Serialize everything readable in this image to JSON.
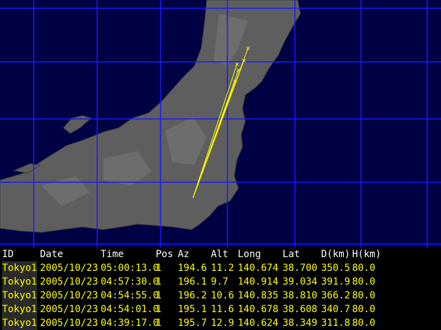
{
  "colors": {
    "grid": "#1a1aff",
    "track": "#ffff00",
    "land": "#5a5a5a",
    "sea": "#000044"
  },
  "table": {
    "headers": [
      "ID",
      "Date",
      "Time",
      "Pos",
      "Az",
      "Alt",
      "Long",
      "Lat",
      "D(km)",
      "H(km)"
    ],
    "rows": [
      [
        "Tokyo1",
        "2005/10/23",
        "05:00:13.0",
        "1",
        "194.6",
        "11.2",
        "140.674",
        "38.700",
        "350.5",
        "80.0"
      ],
      [
        "Tokyo1",
        "2005/10/23",
        "04:57:30.0",
        "1",
        "196.1",
        "9.7",
        "140.914",
        "39.034",
        "391.9",
        "80.0"
      ],
      [
        "Tokyo1",
        "2005/10/23",
        "04:54:55.0",
        "1",
        "196.2",
        "10.6",
        "140.835",
        "38.810",
        "366.2",
        "80.0"
      ],
      [
        "Tokyo1",
        "2005/10/23",
        "04:54:01.0",
        "1",
        "195.1",
        "11.6",
        "140.678",
        "38.608",
        "340.7",
        "80.0"
      ],
      [
        "Tokyo1",
        "2005/10/23",
        "04:39:17.0",
        "1",
        "195.7",
        "12.9",
        "140.624",
        "38.349",
        "311.8",
        "80.0"
      ]
    ]
  }
}
